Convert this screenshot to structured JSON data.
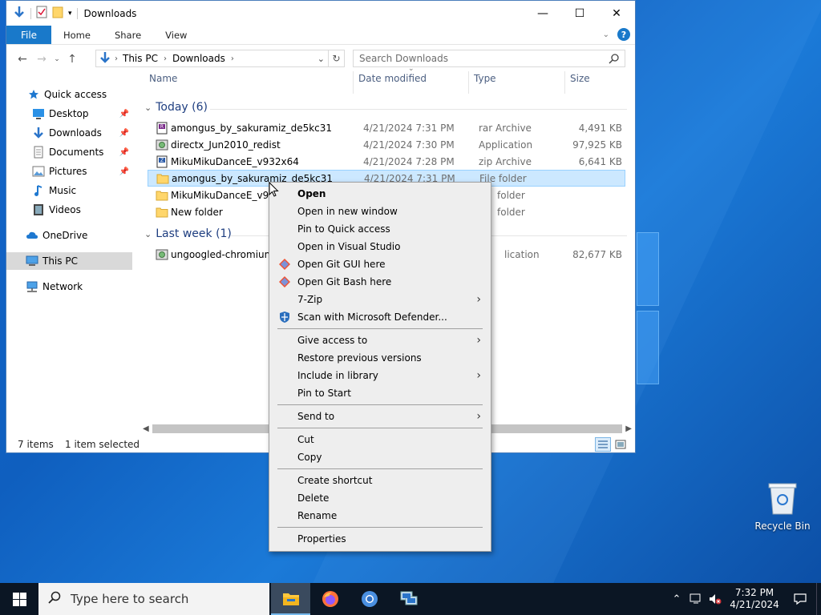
{
  "window": {
    "title": "Downloads",
    "controls": {
      "minimize": "—",
      "maximize": "☐",
      "close": "✕"
    }
  },
  "ribbon": {
    "tabs": [
      "File",
      "Home",
      "Share",
      "View"
    ]
  },
  "address": {
    "segments": [
      "This PC",
      "Downloads"
    ],
    "search_placeholder": "Search Downloads"
  },
  "sidebar": {
    "items": [
      {
        "label": "Quick access",
        "icon": "star-icon",
        "pinned": false
      },
      {
        "label": "Desktop",
        "icon": "desktop-icon",
        "pinned": true
      },
      {
        "label": "Downloads",
        "icon": "download-icon",
        "pinned": true
      },
      {
        "label": "Documents",
        "icon": "document-icon",
        "pinned": true
      },
      {
        "label": "Pictures",
        "icon": "pictures-icon",
        "pinned": true
      },
      {
        "label": "Music",
        "icon": "music-icon",
        "pinned": false
      },
      {
        "label": "Videos",
        "icon": "video-icon",
        "pinned": false
      },
      {
        "label": "OneDrive",
        "icon": "cloud-icon",
        "pinned": false
      },
      {
        "label": "This PC",
        "icon": "computer-icon",
        "pinned": false
      },
      {
        "label": "Network",
        "icon": "network-icon",
        "pinned": false
      }
    ]
  },
  "columns": {
    "name": "Name",
    "date": "Date modified",
    "type": "Type",
    "size": "Size"
  },
  "groups": [
    {
      "label": "Today (6)"
    },
    {
      "label": "Last week (1)"
    }
  ],
  "files": [
    {
      "name": "amongus_by_sakuramiz_de5kc31",
      "date": "4/21/2024 7:31 PM",
      "type": "rar Archive",
      "size": "4,491 KB",
      "icon": "rar-icon"
    },
    {
      "name": "directx_Jun2010_redist",
      "date": "4/21/2024 7:30 PM",
      "type": "Application",
      "size": "97,925 KB",
      "icon": "installer-icon"
    },
    {
      "name": "MikuMikuDanceE_v932x64",
      "date": "4/21/2024 7:28 PM",
      "type": "zip Archive",
      "size": "6,641 KB",
      "icon": "zip-icon"
    },
    {
      "name": "amongus_by_sakuramiz_de5kc31",
      "date": "4/21/2024 7:31 PM",
      "type": "File folder",
      "size": "",
      "icon": "folder-icon"
    },
    {
      "name": "MikuMikuDanceE_v932x",
      "date": "",
      "type": "folder",
      "size": "",
      "icon": "folder-icon"
    },
    {
      "name": "New folder",
      "date": "",
      "type": "folder",
      "size": "",
      "icon": "folder-icon"
    },
    {
      "name": "ungoogled-chromium_1",
      "date": "",
      "type": "lication",
      "size": "82,677 KB",
      "icon": "installer-icon"
    }
  ],
  "status": {
    "count": "7 items",
    "selected": "1 item selected"
  },
  "context_menu": {
    "items": [
      {
        "label": "Open",
        "bold": true
      },
      {
        "label": "Open in new window"
      },
      {
        "label": "Pin to Quick access"
      },
      {
        "label": "Open in Visual Studio"
      },
      {
        "label": "Open Git GUI here",
        "icon": "git-icon"
      },
      {
        "label": "Open Git Bash here",
        "icon": "git-icon"
      },
      {
        "label": "7-Zip",
        "submenu": true
      },
      {
        "label": "Scan with Microsoft Defender...",
        "icon": "defender-icon"
      },
      {
        "label": "Give access to",
        "submenu": true
      },
      {
        "label": "Restore previous versions"
      },
      {
        "label": "Include in library",
        "submenu": true
      },
      {
        "label": "Pin to Start"
      },
      {
        "label": "Send to",
        "submenu": true
      },
      {
        "label": "Cut"
      },
      {
        "label": "Copy"
      },
      {
        "label": "Create shortcut"
      },
      {
        "label": "Delete"
      },
      {
        "label": "Rename"
      },
      {
        "label": "Properties"
      }
    ]
  },
  "desktop": {
    "recycle_bin": "Recycle Bin"
  },
  "taskbar": {
    "search_placeholder": "Type here to search",
    "time": "7:32 PM",
    "date": "4/21/2024"
  }
}
